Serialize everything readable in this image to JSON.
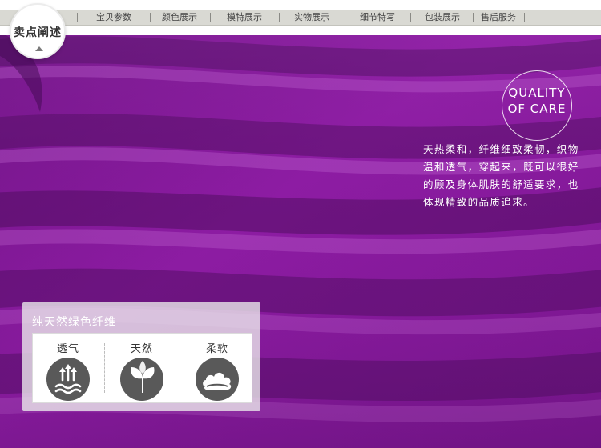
{
  "nav": {
    "badge_label": "卖点阐述",
    "items": [
      "宝贝参数",
      "颜色展示",
      "模特展示",
      "实物展示",
      "细节特写",
      "包装展示",
      "售后服务"
    ]
  },
  "hero": {
    "quality_line1": "QUALITY",
    "quality_line2": "OF CARE",
    "description_lines": [
      "天热柔和，纤维细致柔韧，织物",
      "温和透气，穿起来，既可以很好",
      "的顾及身体肌肤的舒适要求，也",
      "体现精致的品质追求。"
    ]
  },
  "features": {
    "title": "纯天然绿色纤维",
    "items": [
      {
        "label": "透气",
        "icon": "breathable-icon"
      },
      {
        "label": "天然",
        "icon": "leaf-icon"
      },
      {
        "label": "柔软",
        "icon": "cloud-icon"
      }
    ]
  },
  "colors": {
    "fabric_main": "#8a1aa0",
    "fabric_shadow": "#4a0b5b",
    "fabric_highlight": "#b84ccb",
    "icon_circle": "#595959"
  }
}
